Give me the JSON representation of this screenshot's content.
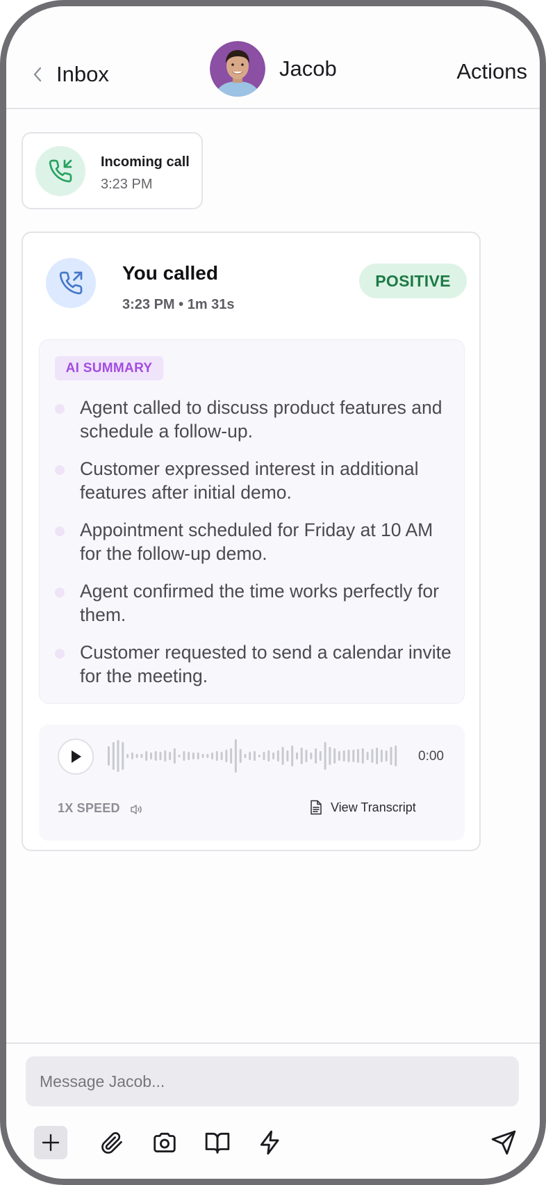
{
  "header": {
    "back_label": "Inbox",
    "contact_name": "Jacob",
    "actions_label": "Actions"
  },
  "incoming_call": {
    "title": "Incoming call",
    "time": "3:23 PM"
  },
  "outgoing_call": {
    "title": "You called",
    "time": "3:23 PM",
    "duration": "1m 31s",
    "meta": "3:23 PM • 1m 31s",
    "sentiment": "POSITIVE",
    "summary": {
      "tag": "AI SUMMARY",
      "items": [
        "Agent called to discuss product features and schedule a follow-up.",
        "Customer expressed interest in additional features after initial demo.",
        "Appointment scheduled for Friday at 10 AM for the follow-up demo.",
        "Agent confirmed the time works perfectly for them.",
        "Customer requested to send a calendar invite for the meeting."
      ]
    },
    "player": {
      "time": "0:00",
      "speed": "1X SPEED",
      "transcript_label": "View Transcript"
    }
  },
  "composer": {
    "placeholder": "Message Jacob..."
  },
  "colors": {
    "positive_bg": "#ddf3e6",
    "positive_text": "#1d7a45",
    "ai_tag_bg": "#f0e4fb",
    "ai_tag_text": "#a34ce0",
    "incoming_icon_bg": "#def3e8",
    "outgoing_icon_bg": "#dce9ff"
  },
  "icons": [
    "chevron-left-icon",
    "phone-incoming-icon",
    "phone-outgoing-icon",
    "play-icon",
    "volume-icon",
    "document-icon",
    "plus-icon",
    "paperclip-icon",
    "camera-icon",
    "book-icon",
    "lightning-icon",
    "send-icon"
  ]
}
